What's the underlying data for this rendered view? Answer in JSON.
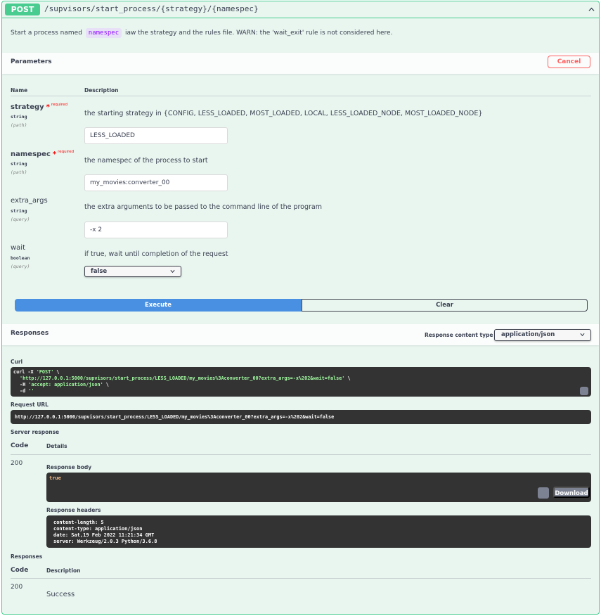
{
  "operation": {
    "method": "POST",
    "path": "/supvisors/start_process/{strategy}/{namespec}",
    "description_before": "Start a process named",
    "description_code": "namespec",
    "description_after": "iaw the strategy and the rules file. WARN: the 'wait_exit' rule is not considered here."
  },
  "parameters": {
    "title": "Parameters",
    "cancel_label": "Cancel",
    "col_name": "Name",
    "col_description": "Description",
    "required_label": "required",
    "items": [
      {
        "name": "strategy",
        "type": "string",
        "in": "(path)",
        "description": "the starting strategy in {CONFIG, LESS_LOADED, MOST_LOADED, LOCAL, LESS_LOADED_NODE, MOST_LOADED_NODE}",
        "value": "LESS_LOADED"
      },
      {
        "name": "namespec",
        "type": "string",
        "in": "(path)",
        "description": "the namespec of the process to start",
        "value": "my_movies:converter_00"
      },
      {
        "name": "extra_args",
        "type": "string",
        "in": "(query)",
        "description": "the extra arguments to be passed to the command line of the program",
        "value": "-x 2"
      },
      {
        "name": "wait",
        "type": "boolean",
        "in": "(query)",
        "description": "if true, wait until completion of the request",
        "value": "false"
      }
    ]
  },
  "actions": {
    "execute_label": "Execute",
    "clear_label": "Clear"
  },
  "responses_section": {
    "title": "Responses",
    "content_type_label": "Response content type",
    "content_type_value": "application/json"
  },
  "curl": {
    "label": "Curl",
    "line1_prefix": "curl -X ",
    "line1_method": "'POST'",
    "line1_suffix": " \\",
    "line2_url": "'http://127.0.0.1:5000/supvisors/start_process/LESS_LOADED/my_movies%3Aconverter_00?extra_args=-x%202&wait=false'",
    "line2_suffix": " \\",
    "line3_prefix": "-H ",
    "line3_header": "'accept: application/json'",
    "line3_suffix": " \\",
    "line4_prefix": "-d ",
    "line4_data": "''"
  },
  "request_url": {
    "label": "Request URL",
    "value": "http://127.0.0.1:5000/supvisors/start_process/LESS_LOADED/my_movies%3Aconverter_00?extra_args=-x%202&wait=false"
  },
  "server_response": {
    "label": "Server response",
    "col_code": "Code",
    "col_details": "Details",
    "code": "200",
    "body_label": "Response body",
    "body": "true",
    "download_label": "Download",
    "headers_label": "Response headers",
    "headers": [
      "content-length: 5",
      "content-type: application/json",
      "date: Sat,19 Feb 2022 11:21:34 GMT",
      "server: Werkzeug/2.0.3 Python/3.6.8"
    ]
  },
  "documented_responses": {
    "label": "Responses",
    "col_code": "Code",
    "col_description": "Description",
    "code": "200",
    "description": "Success"
  },
  "colors": {
    "post_green": "#49cc90",
    "execute_blue": "#4990e2",
    "cancel_red": "#ff6060",
    "code_bg": "#333333"
  }
}
